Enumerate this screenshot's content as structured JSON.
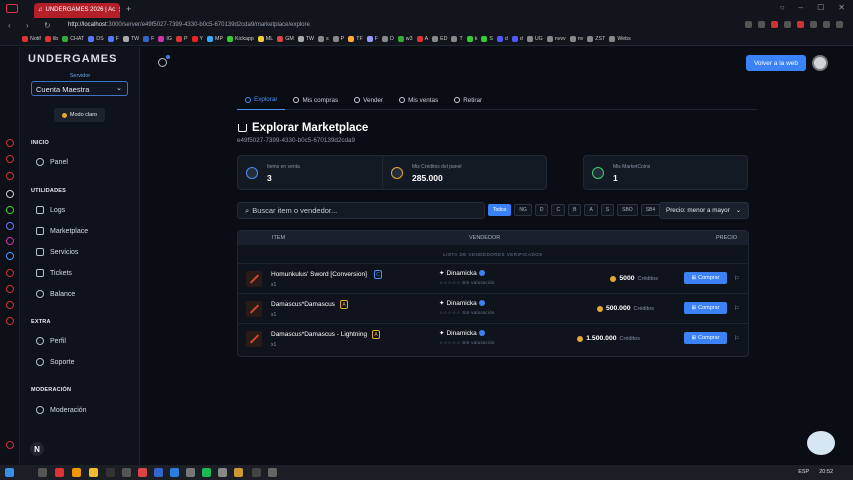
{
  "browser": {
    "tab_title": "UNDERGAMES 2026 | Ac",
    "url_prefix": "http://localhost",
    "url_rest": ":3000/server/e49f5027-7399-4330-b0c5-670139d2cda9/marketplace/explore",
    "bookmarks": [
      {
        "label": "Notif",
        "color": "#d33"
      },
      {
        "label": "lib",
        "color": "#d33"
      },
      {
        "label": "CHAT",
        "color": "#3a3"
      },
      {
        "label": "DS",
        "color": "#57f"
      },
      {
        "label": "F",
        "color": "#57f"
      },
      {
        "label": "TW",
        "color": "#aaa"
      },
      {
        "label": "F",
        "color": "#36c"
      },
      {
        "label": "IG",
        "color": "#c3a"
      },
      {
        "label": "P",
        "color": "#d33"
      },
      {
        "label": "Y",
        "color": "#e22"
      },
      {
        "label": "MP",
        "color": "#3af"
      },
      {
        "label": "Kickapp",
        "color": "#3c3"
      },
      {
        "label": "ML",
        "color": "#ec3"
      },
      {
        "label": "GM",
        "color": "#d44"
      },
      {
        "label": "TW",
        "color": "#aaa"
      },
      {
        "label": "s",
        "color": "#888"
      },
      {
        "label": "P",
        "color": "#888"
      },
      {
        "label": "TF",
        "color": "#fa3"
      },
      {
        "label": "F",
        "color": "#99f"
      },
      {
        "label": "D",
        "color": "#888"
      },
      {
        "label": "w3",
        "color": "#3a3"
      },
      {
        "label": "A",
        "color": "#d33"
      },
      {
        "label": "ED",
        "color": "#888"
      },
      {
        "label": "T",
        "color": "#888"
      },
      {
        "label": "k",
        "color": "#3c3"
      },
      {
        "label": "S",
        "color": "#3c3"
      },
      {
        "label": "d",
        "color": "#55f"
      },
      {
        "label": "d",
        "color": "#55f"
      },
      {
        "label": "UG",
        "color": "#888"
      },
      {
        "label": "nvvv",
        "color": "#888"
      },
      {
        "label": "nv",
        "color": "#888"
      },
      {
        "label": "ZST",
        "color": "#888"
      },
      {
        "label": "Webs",
        "color": "#888"
      }
    ]
  },
  "sidebar": {
    "logo": "UNDERGAMES",
    "server_label": "Servidor",
    "server_value": "Cuenta Maestra",
    "light_mode": "Modo claro",
    "sections": {
      "inicio": "INICIO",
      "utilidades": "UTILIDADES",
      "extra": "EXTRA",
      "moderacion": "MODERACIÓN"
    },
    "items": {
      "panel": "Panel",
      "logs": "Logs",
      "marketplace": "Marketplace",
      "servicios": "Servicios",
      "tickets": "Tickets",
      "balance": "Balance",
      "perfil": "Perfil",
      "soporte": "Soporte",
      "moderacion": "Moderación"
    },
    "bottom_badge": "N"
  },
  "header": {
    "back_button": "Volver a la web"
  },
  "tabs": [
    "Explorar",
    "Mis compras",
    "Vender",
    "Mis ventas",
    "Retirar"
  ],
  "page": {
    "title": "Explorar Marketplace",
    "id": "e49f5027-7399-4330-b0c5-670139d2cda9"
  },
  "stats": [
    {
      "label": "Items en venta",
      "value": "3",
      "color": "#4d8ff5"
    },
    {
      "label": "Mis Créditos del panel",
      "value": "285.000",
      "color": "#e4a82f"
    },
    {
      "label": "Mis MarketCoins",
      "value": "1",
      "color": "#3ccf6e"
    }
  ],
  "search": {
    "placeholder": "Buscar item o vendedor..."
  },
  "filters": [
    "Todos",
    "NG",
    "D",
    "C",
    "B",
    "A",
    "S",
    "SBO",
    "SB4"
  ],
  "sort": {
    "value": "Precio: menor a mayor"
  },
  "table": {
    "headers": {
      "item": "ITEM",
      "seller": "VENDEDOR",
      "price": "PRECIO"
    },
    "verified_note": "LISTA DE VENDEDORES VERIFICADOS",
    "rows": [
      {
        "name": "Homunkulus' Sword [Conversion]",
        "grade": "C",
        "grade_color": "#4d8ff5",
        "qty": "x1",
        "seller": "Dinamicka",
        "rating": "☆☆☆☆☆ Sin valoración",
        "price": "5000",
        "credits": "Créditos",
        "buy": "Comprar"
      },
      {
        "name": "Damascus*Damascus",
        "grade": "A",
        "grade_color": "#e4a82f",
        "qty": "x1",
        "seller": "Dinamicka",
        "rating": "☆☆☆☆☆ Sin valoración",
        "price": "500.000",
        "credits": "Créditos",
        "buy": "Comprar"
      },
      {
        "name": "Damascus*Damascus - Lightning",
        "grade": "A",
        "grade_color": "#e4a82f",
        "qty": "x1",
        "seller": "Dinamicka",
        "rating": "☆☆☆☆☆ Sin valoración",
        "price": "1.500.000",
        "credits": "Créditos",
        "buy": "Comprar"
      }
    ]
  },
  "taskbar": {
    "lang": "ESP",
    "time": "20:52"
  }
}
